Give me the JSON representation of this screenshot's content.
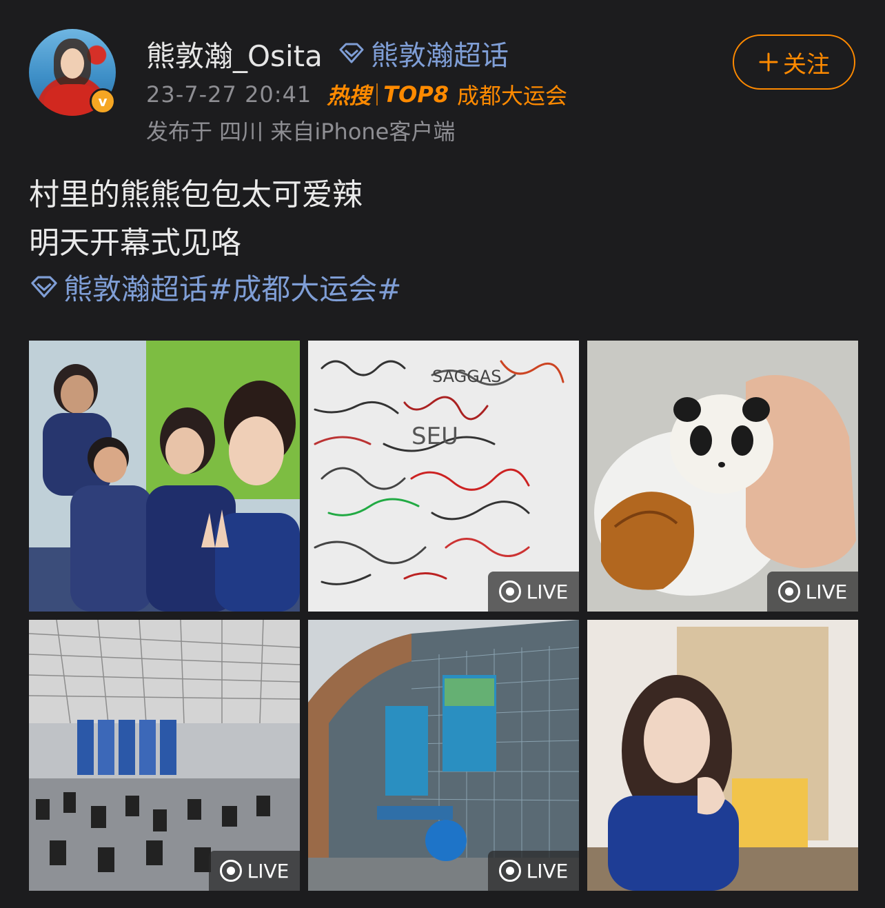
{
  "post": {
    "author": "熊敦瀚_Osita",
    "super_topic": "熊敦瀚超话",
    "timestamp": "23-7-27 20:41",
    "hot_badge": "热搜",
    "hot_rank": "TOP8",
    "hot_topic": "成都大运会",
    "source": "发布于 四川  来自iPhone客户端",
    "follow_label": "关注",
    "text_line1": "村里的熊熊包包太可爱辣",
    "text_line2": "明天开幕式见咯",
    "topic_link": "熊敦瀚超话#成都大运会#",
    "live_label": "LIVE"
  },
  "colors": {
    "background": "#1c1c1e",
    "accent_orange": "#ff8a00",
    "link_blue": "#7f9ed6",
    "verified_badge": "#f5a623"
  },
  "photos": [
    {
      "name": "photo-group-selfie",
      "live": false
    },
    {
      "name": "photo-signature-wall",
      "live": true
    },
    {
      "name": "photo-panda-bun",
      "live": true
    },
    {
      "name": "photo-gym",
      "live": true
    },
    {
      "name": "photo-venue-building",
      "live": true
    },
    {
      "name": "photo-dorm-portrait",
      "live": false
    }
  ]
}
